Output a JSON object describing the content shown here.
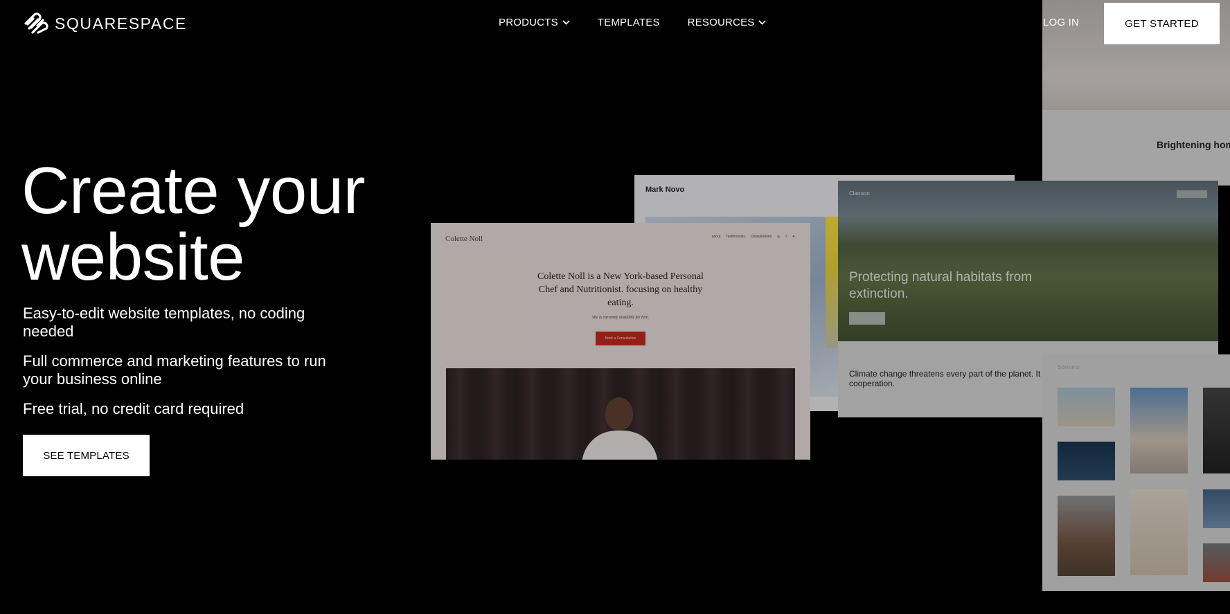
{
  "brand": {
    "name": "SQUARESPACE"
  },
  "nav": {
    "items": [
      {
        "label": "PRODUCTS",
        "has_dropdown": true
      },
      {
        "label": "TEMPLATES",
        "has_dropdown": false
      },
      {
        "label": "RESOURCES",
        "has_dropdown": true
      }
    ],
    "login_label": "LOG IN",
    "get_started_label": "GET STARTED"
  },
  "hero": {
    "title": "Create your website",
    "bullets": [
      "Easy-to-edit website templates, no coding needed",
      "Full commerce and marketing features to run your business online",
      "Free trial, no credit card required"
    ],
    "cta_label": "SEE TEMPLATES"
  },
  "previews": {
    "mark_novo": {
      "name": "Mark Novo"
    },
    "colette": {
      "logo": "Colette Noll",
      "nav": [
        "about",
        "Testimonials",
        "Consultations"
      ],
      "headline": "Colette Noll is a New York-based Personal Chef and Nutritionist. focusing on healthy eating.",
      "subline": "She is currently available for hire.",
      "button": "Book a Consultation"
    },
    "habitat": {
      "logo": "Clanoon",
      "headline": "Protecting natural habitats from extinction.",
      "body": "Climate change threatens every part of the planet. It is a global problem that requires global cooperation."
    },
    "bright": {
      "text": "Brightening home durable p"
    },
    "gallery": {
      "title": "Scenario"
    }
  },
  "colors": {
    "background": "#000000",
    "button_bg": "#ffffff",
    "button_text": "#000000",
    "accent_red": "#b5261c"
  }
}
